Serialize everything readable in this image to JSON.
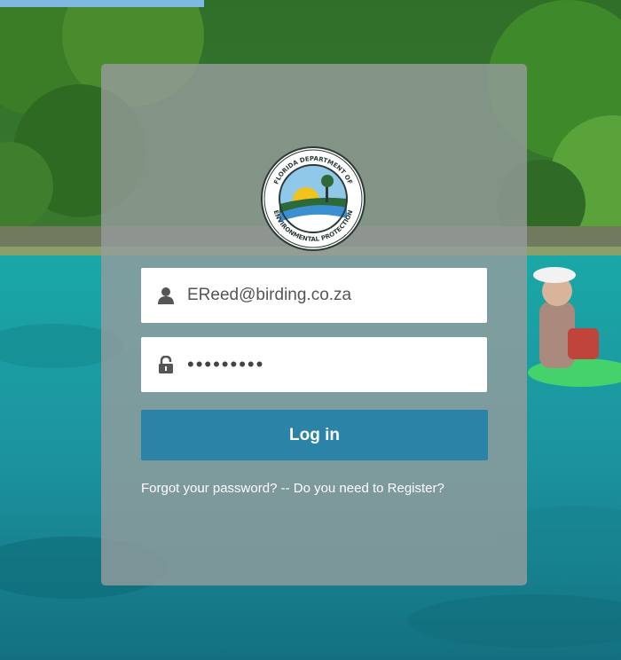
{
  "login": {
    "username_value": "EReed@birding.co.za",
    "password_value": "•••••••••",
    "login_button_label": "Log in",
    "forgot_link": "Forgot your password?",
    "separator": " -- ",
    "register_link": "Do you need to Register?"
  },
  "logo": {
    "text": "FLORIDA DEPARTMENT OF ENVIRONMENTAL PROTECTION"
  },
  "colors": {
    "button": "#2b83a8",
    "card_overlay": "#969c9c",
    "water": "#1fa3a8",
    "foliage": "#3f7a2a"
  },
  "icons": {
    "username": "user-icon",
    "password": "padlock-icon"
  }
}
